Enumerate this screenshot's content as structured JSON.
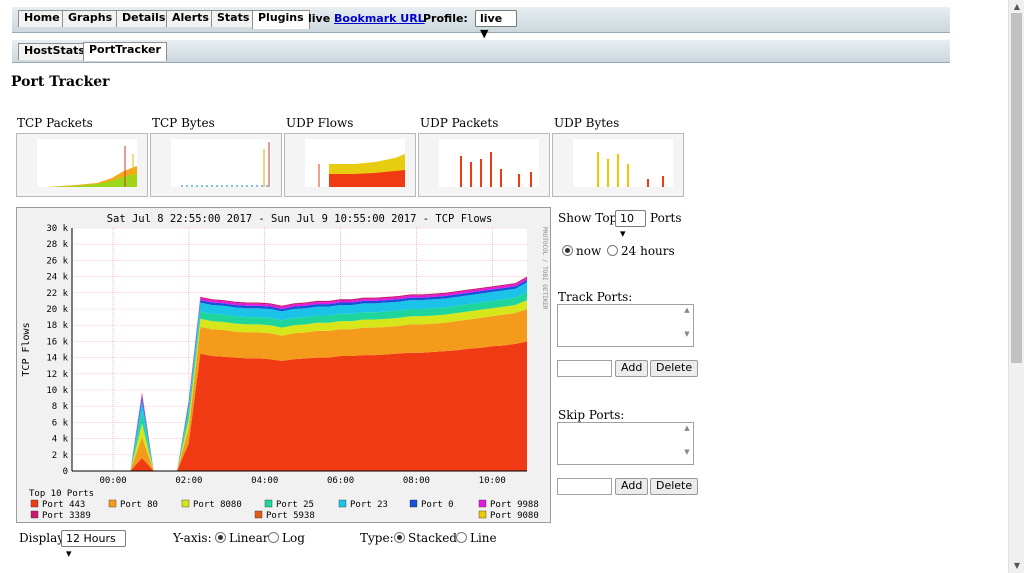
{
  "nav": {
    "tabs": [
      "Home",
      "Graphs",
      "Details",
      "Alerts",
      "Stats",
      "Plugins"
    ],
    "active_tab": "Plugins",
    "live": "live",
    "bookmark": "Bookmark URL",
    "profile_label": "Profile:",
    "profile_value": "live ▼"
  },
  "subnav": {
    "tabs": [
      "HostStats",
      "PortTracker"
    ],
    "active": "PortTracker"
  },
  "page": {
    "title": "Port Tracker"
  },
  "thumbnails": [
    "TCP Packets",
    "TCP Bytes",
    "UDP Flows",
    "UDP Packets",
    "UDP Bytes"
  ],
  "sidebar": {
    "show_top_label": "Show Top",
    "show_top_value": "10 ▾",
    "ports_label": "Ports",
    "radio_now": "now",
    "radio_24": "24 hours",
    "track_ports": "Track Ports:",
    "skip_ports": "Skip Ports:",
    "add": "Add",
    "delete": "Delete"
  },
  "bottom": {
    "display_label": "Display",
    "display_value": "12 Hours ▾",
    "yaxis_label": "Y-axis:",
    "yaxis_linear": "Linear",
    "yaxis_log": "Log",
    "type_label": "Type:",
    "type_stacked": "Stacked",
    "type_line": "Line"
  },
  "chart_data": {
    "type": "area",
    "title": "Sat Jul  8 22:55:00 2017 - Sun Jul  9 10:55:00 2017 - TCP Flows",
    "ylabel": "TCP Flows",
    "side_label": "PROTOCOL / TOBI OETIKER",
    "y_ticks": [
      "0",
      "2 k",
      "4 k",
      "6 k",
      "8 k",
      "10 k",
      "12 k",
      "14 k",
      "16 k",
      "18 k",
      "20 k",
      "22 k",
      "24 k",
      "26 k",
      "28 k",
      "30 k"
    ],
    "ylim": [
      0,
      30000
    ],
    "x_ticks": [
      "00:00",
      "02:00",
      "04:00",
      "06:00",
      "08:00",
      "10:00"
    ],
    "x_tick_hours": [
      1.083,
      3.083,
      5.083,
      7.083,
      9.083,
      11.083
    ],
    "legend_title": "Top 10 Ports",
    "series": [
      {
        "name": "Port 443",
        "color": "#f03a14",
        "values": [
          0,
          0,
          0,
          0,
          0,
          0,
          1600,
          0,
          0,
          0,
          3400,
          14500,
          14200,
          14100,
          14000,
          13900,
          13900,
          13800,
          13600,
          13800,
          13900,
          14000,
          14000,
          14200,
          14200,
          14300,
          14300,
          14400,
          14500,
          14600,
          14600,
          14700,
          14800,
          14900,
          15100,
          15200,
          15400,
          15500,
          15700,
          16000
        ]
      },
      {
        "name": "Port 80",
        "color": "#f49b1c",
        "values": [
          0,
          0,
          0,
          0,
          0,
          0,
          2600,
          0,
          0,
          0,
          1800,
          3300,
          3300,
          3300,
          3200,
          3200,
          3200,
          3200,
          3100,
          3200,
          3200,
          3300,
          3300,
          3300,
          3300,
          3400,
          3400,
          3400,
          3400,
          3500,
          3500,
          3500,
          3500,
          3600,
          3600,
          3700,
          3700,
          3800,
          3800,
          4000
        ]
      },
      {
        "name": "Port 8080",
        "color": "#d6e61a",
        "values": [
          0,
          0,
          0,
          0,
          0,
          0,
          1700,
          0,
          0,
          0,
          1200,
          1000,
          1000,
          1000,
          1000,
          1000,
          1000,
          1000,
          1000,
          1000,
          1000,
          1000,
          1000,
          1000,
          1000,
          1000,
          1000,
          1000,
          1000,
          1000,
          1000,
          1000,
          1000,
          1000,
          1000,
          1000,
          1000,
          1000,
          1000,
          1100
        ]
      },
      {
        "name": "Port 25",
        "color": "#1ed69c",
        "values": [
          0,
          0,
          0,
          0,
          0,
          0,
          1400,
          0,
          0,
          0,
          900,
          900,
          900,
          900,
          900,
          900,
          900,
          900,
          900,
          900,
          900,
          900,
          900,
          900,
          900,
          900,
          900,
          900,
          900,
          900,
          900,
          900,
          900,
          900,
          900,
          900,
          900,
          900,
          900,
          1000
        ]
      },
      {
        "name": "Port 23",
        "color": "#1cc3e8",
        "values": [
          0,
          0,
          0,
          0,
          0,
          0,
          1400,
          0,
          0,
          0,
          800,
          1100,
          1100,
          1100,
          1100,
          1100,
          1100,
          1100,
          1100,
          1100,
          1100,
          1100,
          1100,
          1100,
          1100,
          1100,
          1100,
          1100,
          1100,
          1100,
          1100,
          1100,
          1100,
          1100,
          1100,
          1100,
          1100,
          1100,
          1100,
          1200
        ]
      },
      {
        "name": "Port 0",
        "color": "#1452d8",
        "values": [
          0,
          0,
          0,
          0,
          0,
          0,
          500,
          0,
          0,
          0,
          300,
          300,
          300,
          300,
          300,
          300,
          300,
          300,
          300,
          300,
          300,
          300,
          300,
          300,
          300,
          300,
          300,
          300,
          300,
          300,
          300,
          300,
          300,
          300,
          300,
          300,
          300,
          300,
          300,
          300
        ]
      },
      {
        "name": "Port 9988",
        "color": "#e21ae0",
        "values": [
          0,
          0,
          0,
          0,
          0,
          0,
          300,
          0,
          0,
          0,
          200,
          250,
          250,
          250,
          250,
          250,
          250,
          250,
          250,
          250,
          250,
          250,
          250,
          250,
          250,
          250,
          250,
          250,
          250,
          250,
          250,
          250,
          250,
          250,
          250,
          250,
          250,
          250,
          250,
          250
        ]
      },
      {
        "name": "Port 3389",
        "color": "#c8196e",
        "values": [
          0,
          0,
          0,
          0,
          0,
          0,
          200,
          0,
          0,
          0,
          100,
          150,
          150,
          150,
          150,
          150,
          150,
          150,
          150,
          150,
          150,
          150,
          150,
          150,
          150,
          150,
          150,
          150,
          150,
          150,
          150,
          150,
          150,
          150,
          150,
          150,
          150,
          150,
          150,
          150
        ]
      },
      {
        "name": "Port 5938",
        "color": "#e05a16",
        "values": [
          0,
          0,
          0,
          0,
          0,
          0,
          0,
          0,
          0,
          0,
          0,
          0,
          0,
          0,
          0,
          0,
          0,
          0,
          0,
          0,
          0,
          0,
          0,
          0,
          0,
          0,
          0,
          0,
          0,
          0,
          0,
          0,
          0,
          0,
          0,
          0,
          0,
          0,
          0,
          0
        ]
      },
      {
        "name": "Port 9080",
        "color": "#f0c800",
        "values": [
          0,
          0,
          0,
          0,
          0,
          0,
          0,
          0,
          0,
          0,
          0,
          0,
          0,
          0,
          0,
          0,
          0,
          0,
          0,
          0,
          0,
          0,
          0,
          0,
          0,
          0,
          0,
          0,
          0,
          0,
          0,
          0,
          0,
          0,
          0,
          0,
          0,
          0,
          0,
          0
        ]
      }
    ]
  }
}
